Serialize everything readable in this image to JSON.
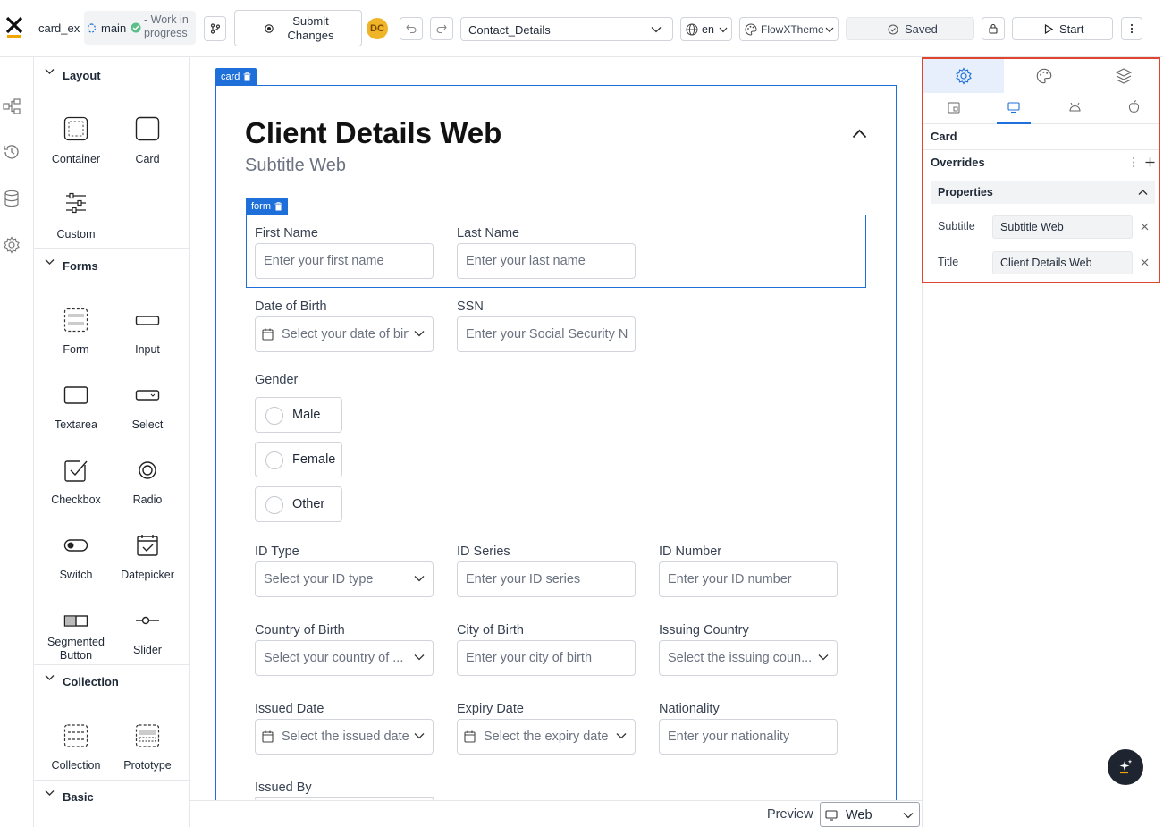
{
  "topbar": {
    "project_name": "card_ex",
    "branch": "main",
    "branch_status": "- Work in progress",
    "submit_label": "Submit Changes",
    "avatar_initials": "DC",
    "ui_template": "Contact_Details",
    "language": "en",
    "theme": "FlowXTheme",
    "save_status": "Saved",
    "start_label": "Start"
  },
  "palette": {
    "sections": [
      {
        "title": "Layout",
        "items": [
          "Container",
          "Card",
          "Custom"
        ]
      },
      {
        "title": "Forms",
        "items": [
          "Form",
          "Input",
          "Textarea",
          "Select",
          "Checkbox",
          "Radio",
          "Switch",
          "Datepicker",
          "Segmented Button",
          "Slider"
        ]
      },
      {
        "title": "Collection",
        "items": [
          "Collection",
          "Prototype"
        ]
      },
      {
        "title": "Basic",
        "items": []
      }
    ]
  },
  "canvas": {
    "card_tag": "card",
    "form_tag": "form",
    "card_title": "Client Details Web",
    "card_subtitle": "Subtitle Web",
    "fields": {
      "first_name": {
        "label": "First Name",
        "placeholder": "Enter your first name"
      },
      "last_name": {
        "label": "Last Name",
        "placeholder": "Enter your last name"
      },
      "dob": {
        "label": "Date of Birth",
        "placeholder": "Select your date of birth"
      },
      "ssn": {
        "label": "SSN",
        "placeholder": "Enter your Social Security Number"
      },
      "gender": {
        "label": "Gender",
        "options": [
          "Male",
          "Female",
          "Other"
        ]
      },
      "id_type": {
        "label": "ID Type",
        "placeholder": "Select your ID type"
      },
      "id_series": {
        "label": "ID Series",
        "placeholder": "Enter your ID series"
      },
      "id_number": {
        "label": "ID Number",
        "placeholder": "Enter your ID number"
      },
      "country_birth": {
        "label": "Country of Birth",
        "placeholder": "Select your country of ..."
      },
      "city_birth": {
        "label": "City of Birth",
        "placeholder": "Enter your city of birth"
      },
      "issuing_country": {
        "label": "Issuing Country",
        "placeholder": "Select the issuing coun..."
      },
      "issued_date": {
        "label": "Issued Date",
        "placeholder": "Select the issued date"
      },
      "expiry_date": {
        "label": "Expiry Date",
        "placeholder": "Select the expiry date"
      },
      "nationality": {
        "label": "Nationality",
        "placeholder": "Enter your nationality"
      },
      "issued_by": {
        "label": "Issued By"
      }
    }
  },
  "bottombar": {
    "preview_label": "Preview",
    "platform": "Web"
  },
  "right_panel": {
    "component_name": "Card",
    "overrides_label": "Overrides",
    "properties_label": "Properties",
    "props": [
      {
        "label": "Subtitle",
        "value": "Subtitle Web"
      },
      {
        "label": "Title",
        "value": "Client Details Web"
      }
    ]
  },
  "colors": {
    "accent": "#1e6fd9",
    "highlight": "#e0452f",
    "avatar": "#f0b429"
  }
}
